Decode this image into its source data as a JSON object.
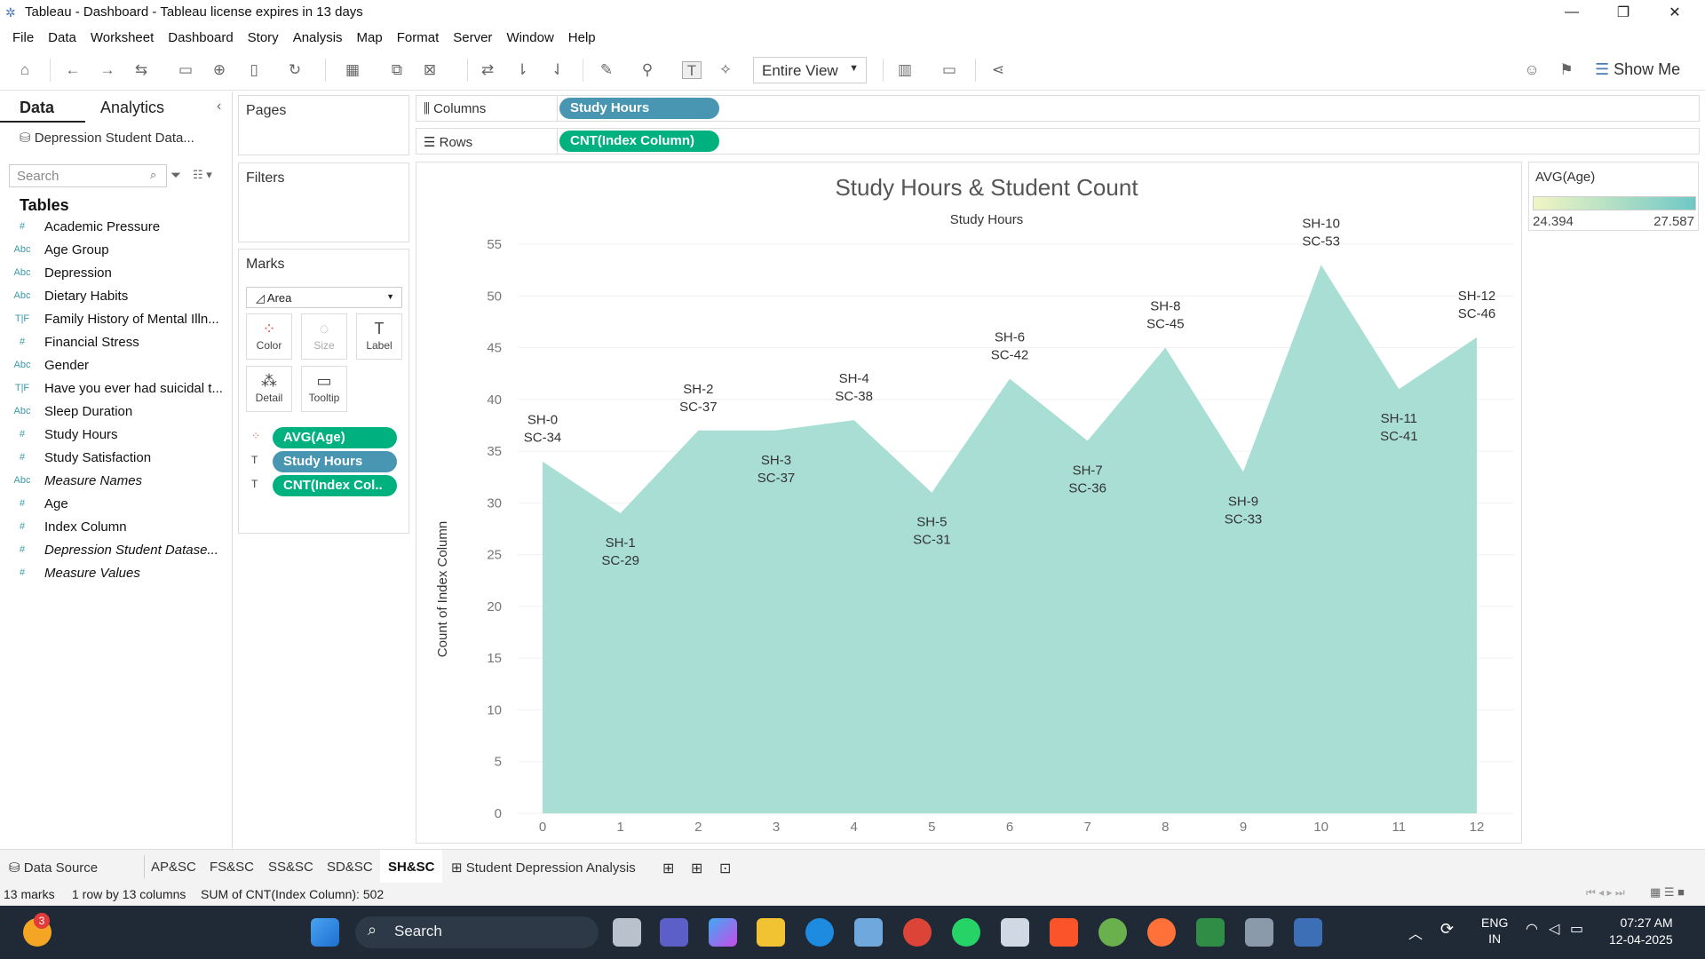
{
  "window": {
    "title": "Tableau - Dashboard - Tableau license expires in 13 days"
  },
  "menu": [
    "File",
    "Data",
    "Worksheet",
    "Dashboard",
    "Story",
    "Analysis",
    "Map",
    "Format",
    "Server",
    "Window",
    "Help"
  ],
  "toolbar": {
    "view_select": "Entire View",
    "show_me": "Show Me"
  },
  "left": {
    "tab_data": "Data",
    "tab_analytics": "Analytics",
    "datasource": "Depression Student Data...",
    "search_placeholder": "Search",
    "tables_heading": "Tables",
    "fields": [
      {
        "type": "#",
        "label": "Academic Pressure"
      },
      {
        "type": "Abc",
        "label": "Age Group"
      },
      {
        "type": "Abc",
        "label": "Depression"
      },
      {
        "type": "Abc",
        "label": "Dietary Habits"
      },
      {
        "type": "T|F",
        "label": "Family History of Mental Illn..."
      },
      {
        "type": "#",
        "label": "Financial Stress"
      },
      {
        "type": "Abc",
        "label": "Gender"
      },
      {
        "type": "T|F",
        "label": "Have you ever had suicidal t..."
      },
      {
        "type": "Abc",
        "label": "Sleep Duration"
      },
      {
        "type": "#",
        "label": "Study Hours"
      },
      {
        "type": "#",
        "label": "Study Satisfaction"
      },
      {
        "type": "Abc",
        "label": "Measure Names",
        "italic": true
      },
      {
        "type": "#",
        "label": "Age"
      },
      {
        "type": "#",
        "label": "Index Column"
      },
      {
        "type": "#",
        "label": "Depression Student Datase...",
        "italic": true
      },
      {
        "type": "#",
        "label": "Measure Values",
        "italic": true
      }
    ]
  },
  "shelves": {
    "pages": "Pages",
    "filters": "Filters",
    "marks": "Marks",
    "mark_type": "Area",
    "mark_buttons": [
      "Color",
      "Size",
      "Label",
      "Detail",
      "Tooltip"
    ],
    "mark_pills": [
      "AVG(Age)",
      "Study Hours",
      "CNT(Index Col.."
    ],
    "columns_label": "Columns",
    "columns_pill": "Study Hours",
    "rows_label": "Rows",
    "rows_pill": "CNT(Index Column)"
  },
  "legend": {
    "title": "AVG(Age)",
    "min": "24.394",
    "max": "27.587"
  },
  "chart_data": {
    "type": "area",
    "title": "Study Hours & Student Count",
    "subtitle": "Study Hours",
    "ylabel": "Count of Index Column",
    "xlabel": "",
    "x": [
      0,
      1,
      2,
      3,
      4,
      5,
      6,
      7,
      8,
      9,
      10,
      11,
      12
    ],
    "values": [
      34,
      29,
      37,
      37,
      38,
      31,
      42,
      36,
      45,
      33,
      53,
      41,
      46
    ],
    "labels": [
      [
        "SH-0",
        "SC-34"
      ],
      [
        "SH-1",
        "SC-29"
      ],
      [
        "SH-2",
        "SC-37"
      ],
      [
        "SH-3",
        "SC-37"
      ],
      [
        "SH-4",
        "SC-38"
      ],
      [
        "SH-5",
        "SC-31"
      ],
      [
        "SH-6",
        "SC-42"
      ],
      [
        "SH-7",
        "SC-36"
      ],
      [
        "SH-8",
        "SC-45"
      ],
      [
        "SH-9",
        "SC-33"
      ],
      [
        "SH-10",
        "SC-53"
      ],
      [
        "SH-11",
        "SC-41"
      ],
      [
        "SH-12",
        "SC-46"
      ]
    ],
    "label_above": [
      true,
      false,
      true,
      false,
      true,
      false,
      true,
      false,
      true,
      false,
      true,
      false,
      true
    ],
    "ylim": [
      0,
      55
    ],
    "yticks": [
      0,
      5,
      10,
      15,
      20,
      25,
      30,
      35,
      40,
      45,
      50,
      55
    ],
    "fill": "#a8ded4",
    "grid": true
  },
  "sheet_tabs": [
    "Data Source",
    "AP&SC",
    "FS&SC",
    "SS&SC",
    "SD&SC",
    "SH&SC",
    "Student Depression Analysis"
  ],
  "active_tab": "SH&SC",
  "status": {
    "marks": "13 marks",
    "rows": "1 row by 13 columns",
    "sum": "SUM of CNT(Index Column): 502"
  },
  "taskbar": {
    "search": "Search",
    "lang1": "ENG",
    "lang2": "IN",
    "time": "07:27 AM",
    "date": "12-04-2025",
    "badge": "3"
  }
}
